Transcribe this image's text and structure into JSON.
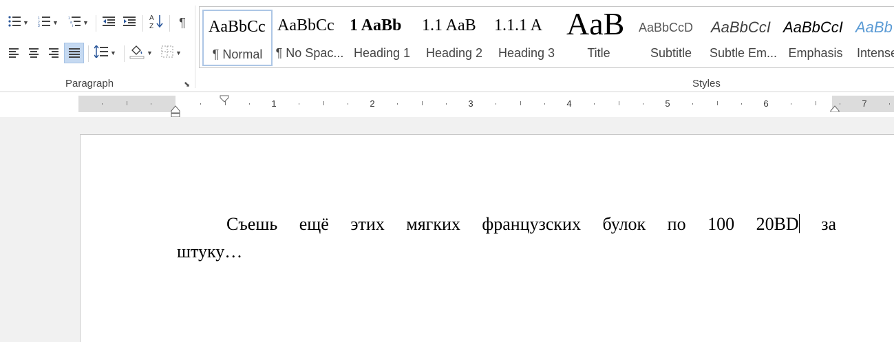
{
  "ribbon": {
    "paragraph_group_label": "Paragraph",
    "styles_group_label": "Styles",
    "launcher_glyph": "⬊",
    "show_marks_glyph": "¶",
    "sort_glyph": "A↓Z",
    "styles": [
      {
        "sample": "AaBbCc",
        "name": "¶ Normal",
        "selected": true
      },
      {
        "sample": "AaBbCc",
        "name": "¶ No Spac..."
      },
      {
        "sample": "1 AaBb",
        "name": "Heading 1"
      },
      {
        "sample": "1.1 AaB",
        "name": "Heading 2"
      },
      {
        "sample": "1.1.1 A",
        "name": "Heading 3"
      },
      {
        "sample": "AaB",
        "name": "Title"
      },
      {
        "sample": "AaBbCcD",
        "name": "Subtitle"
      },
      {
        "sample": "AaBbCcI",
        "name": "Subtle Em..."
      },
      {
        "sample": "AaBbCcI",
        "name": "Emphasis"
      },
      {
        "sample": "AaBb",
        "name": "Intense"
      }
    ]
  },
  "ruler": {
    "numbers": [
      "1",
      "2",
      "3",
      "4",
      "5",
      "6",
      "7"
    ]
  },
  "document": {
    "line1_words": [
      "Съешь",
      "ещё",
      "этих",
      "мягких",
      "французских",
      "булок",
      "по",
      "100"
    ],
    "line1_before_caret": "20BD",
    "line1_after_caret": "за",
    "line2": "штуку…"
  },
  "colors": {
    "selected_button": "#c5d9f1",
    "subtitle_gray": "#595959",
    "intense_blue": "#5b9bd5"
  }
}
